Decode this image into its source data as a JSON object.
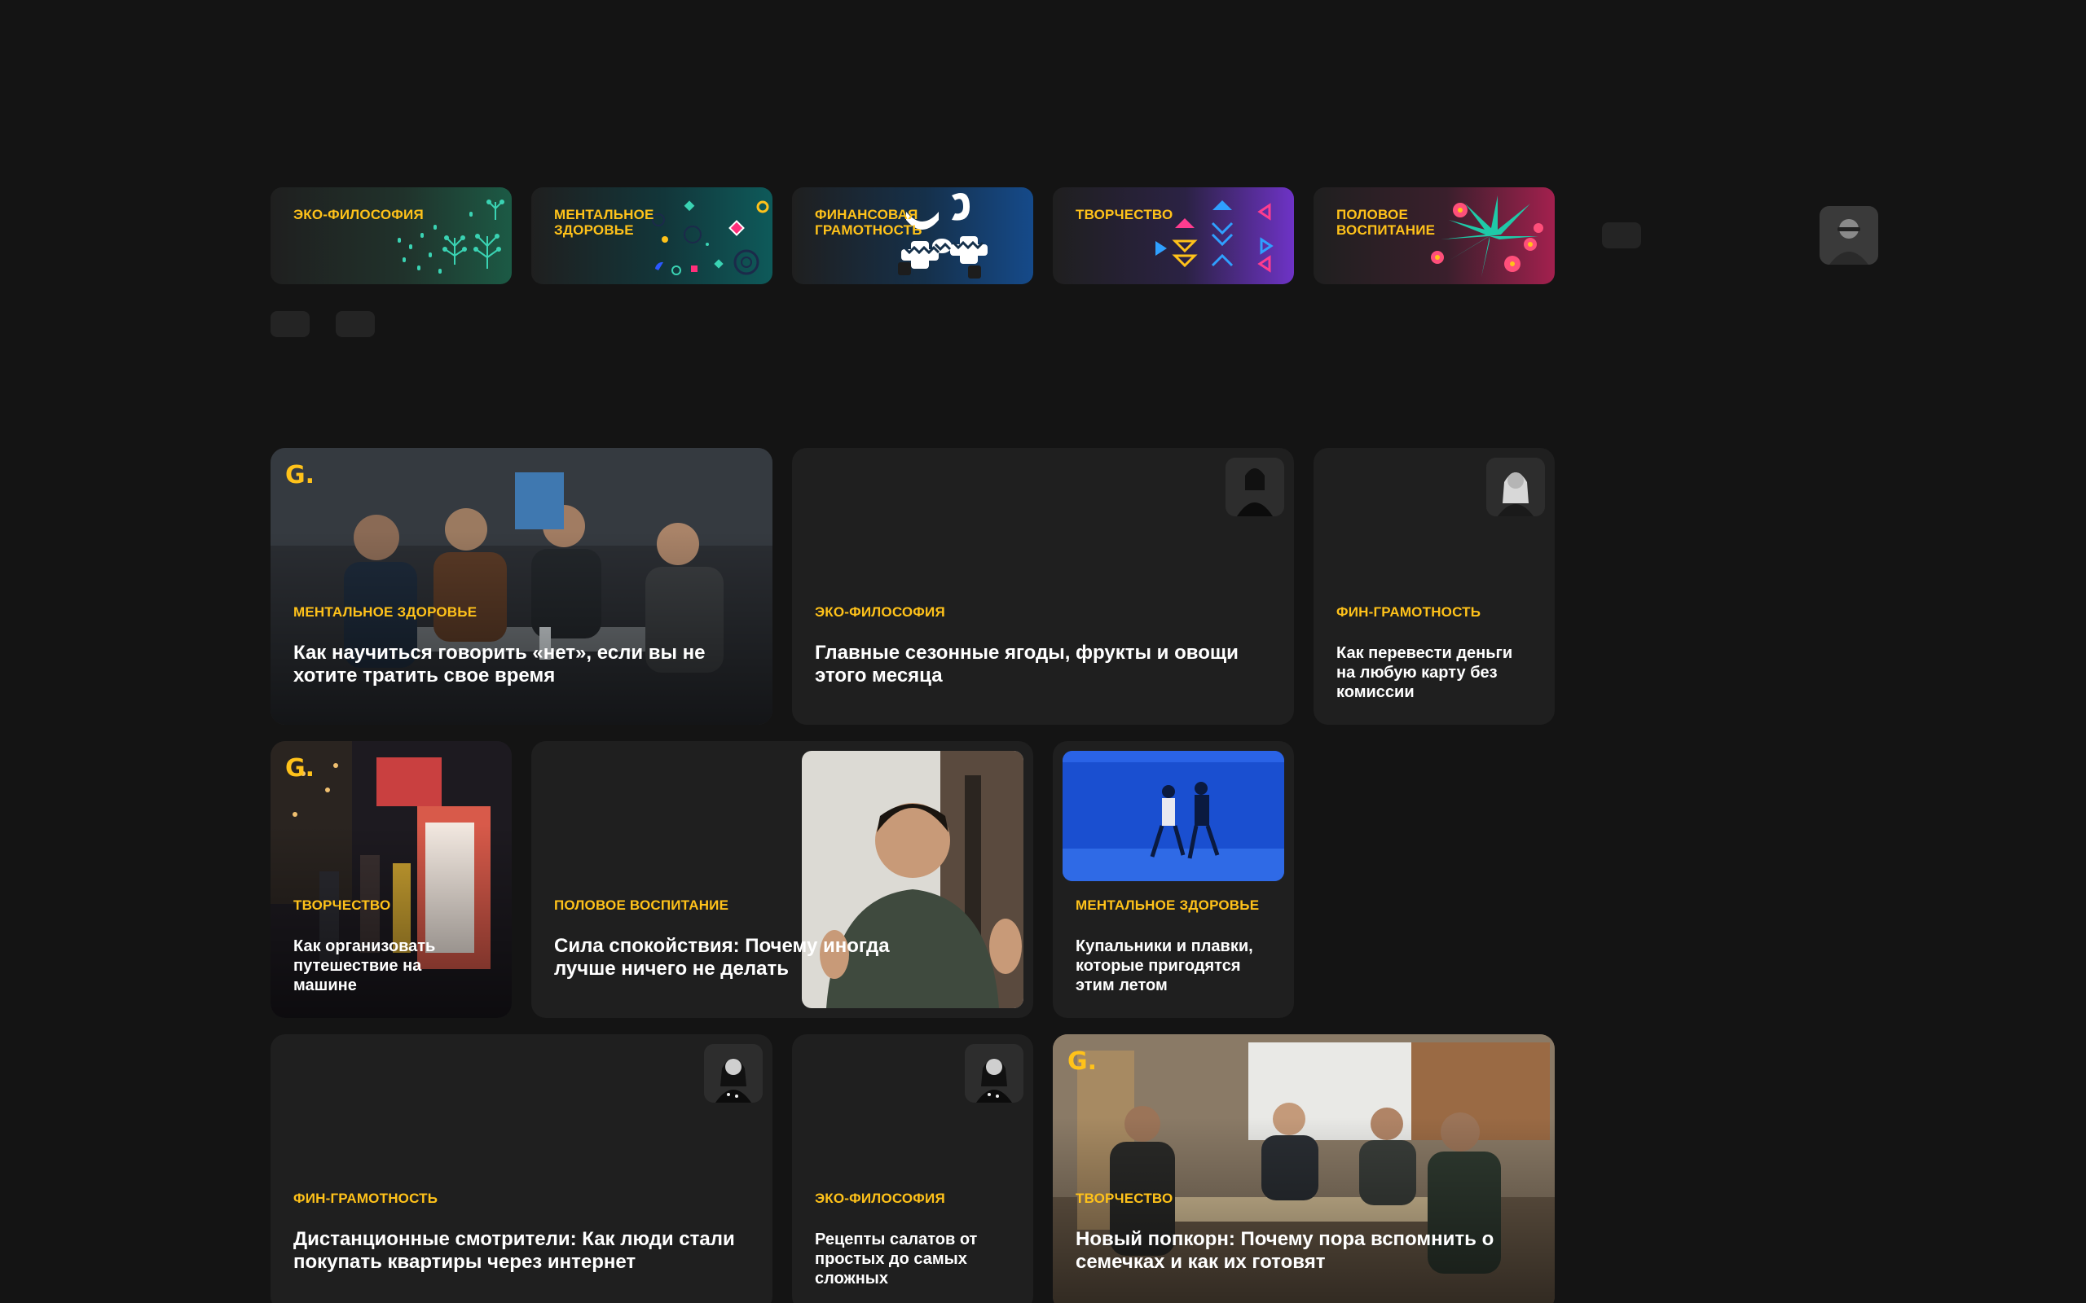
{
  "categories": [
    {
      "label": "ЭКО-ФИЛОСОФИЯ",
      "icon": "eco-sprigs-icon"
    },
    {
      "label": "МЕНТАЛЬНОЕ\nЗДОРОВЬЕ",
      "icon": "mental-shapes-icon"
    },
    {
      "label": "ФИНАНСОВАЯ\nГРАМОТНОСТЬ",
      "icon": "finance-pattern-icon"
    },
    {
      "label": "ТВОРЧЕСТВО",
      "icon": "creativity-triangles-icon"
    },
    {
      "label": "ПОЛОВОЕ\nВОСПИТАНИЕ",
      "icon": "flowers-icon"
    }
  ],
  "cards": [
    {
      "tag": "МЕНТАЛЬНОЕ ЗДОРОВЬЕ",
      "title": "Как научиться говорить «нет», если вы не хотите тратить свое время",
      "badge": "G."
    },
    {
      "tag": "ЭКО-ФИЛОСОФИЯ",
      "title": "Главные сезонные ягоды, фрукты и овощи этого месяца"
    },
    {
      "tag": "ФИН-ГРАМОТНОСТЬ",
      "title": "Как перевести деньги на любую карту без комиссии"
    },
    {
      "tag": "ТВОРЧЕСТВО",
      "title": "Как организовать путешествие на машине",
      "badge": "G."
    },
    {
      "tag": "ПОЛОВОЕ ВОСПИТАНИЕ",
      "title": "Сила спокойствия: Почему иногда лучше ничего не делать"
    },
    {
      "tag": "МЕНТАЛЬНОЕ ЗДОРОВЬЕ",
      "title": "Купальники и плавки, которые пригодятся этим летом"
    },
    {
      "tag": "ФИН-ГРАМОТНОСТЬ",
      "title": "Дистанционные смотрители: Как люди стали покупать квартиры через интернет"
    },
    {
      "tag": "ЭКО-ФИЛОСОФИЯ",
      "title": "Рецепты салатов от простых до самых сложных"
    },
    {
      "tag": "ТВОРЧЕСТВО",
      "title": "Новый попкорн: Почему пора вспомнить о семечках и как их готовят",
      "badge": "G."
    }
  ],
  "colors": {
    "accent": "#ffc21a",
    "background": "#141414",
    "card": "#1f1f1f"
  }
}
